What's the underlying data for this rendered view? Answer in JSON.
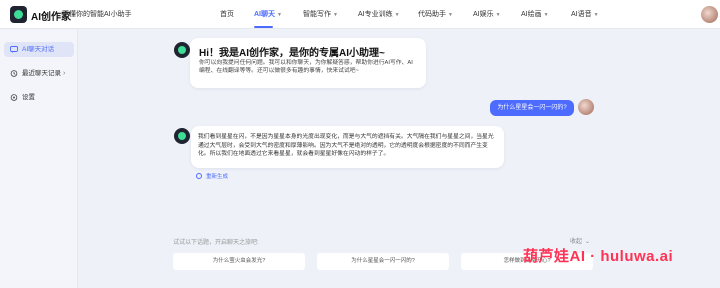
{
  "header": {
    "brand": "AI创作家",
    "slogan": "更懂你的智能AI小助手",
    "nav": [
      {
        "label": "首页",
        "dropdown": false
      },
      {
        "label": "AI聊天",
        "dropdown": true,
        "active": true
      },
      {
        "label": "智能写作",
        "dropdown": true
      },
      {
        "label": "AI专业训练",
        "dropdown": true
      },
      {
        "label": "代码助手",
        "dropdown": true
      },
      {
        "label": "AI娱乐",
        "dropdown": true
      },
      {
        "label": "AI绘画",
        "dropdown": true
      },
      {
        "label": "AI语音",
        "dropdown": true
      }
    ]
  },
  "sidebar": {
    "items": [
      {
        "label": "AI聊天对话",
        "icon": "chat-icon",
        "active": true
      },
      {
        "label": "最近聊天记录",
        "icon": "history-icon",
        "has_arrow": true
      },
      {
        "label": "设置",
        "icon": "settings-icon"
      }
    ]
  },
  "chat": {
    "greeting_title": "Hi！我是AI创作家，是你的专属AI小助理~",
    "greeting_body": "你可以向我提问任何问题。我可以和你聊天，为你解疑答惑，帮助你进行AI写作、AI编程、在线翻译等等。还可以做很多有趣的事情，快来试试吧~",
    "user_question": "为什么星星会一闪一闪的?",
    "answer": "我们看到星星在闪，不是因为星星本身的光度出现变化，而是与大气的遮挡有关。大气隔在我们与星星之间，当星光通过大气层时，会受到大气的密度和厚薄影响。因为大气不是绝对的透明，它的透明度会根据密度的不同而产生变化。所以我们在地面透过它来看星星，就会看到星星好像在闪动的样子了。",
    "regenerate": "重新生成"
  },
  "suggestions": {
    "hint": "试试以下话题，开启聊天之旅吧:",
    "collapse": "收起",
    "items": [
      "为什么萤火虫会发光?",
      "为什么星星会一闪一闪的?",
      "怎样做到日常开心?"
    ]
  },
  "watermark": "葫芦娃AI · huluwa.ai",
  "colors": {
    "accent": "#4d6bfe",
    "background": "#eef1f8",
    "watermark": "#ff3355"
  }
}
